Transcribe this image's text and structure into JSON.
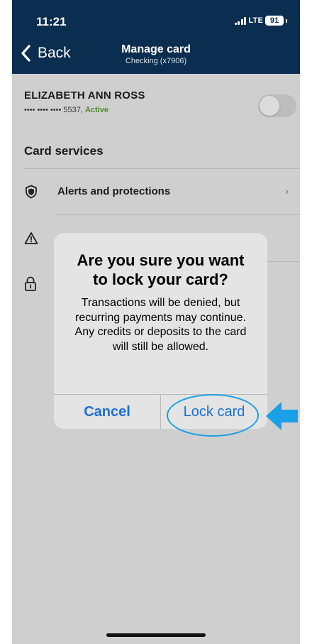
{
  "status_bar": {
    "time": "11:21",
    "network": "LTE",
    "battery": "91"
  },
  "nav": {
    "back_label": "Back",
    "title": "Manage card",
    "subtitle": "Checking (x7906)"
  },
  "card": {
    "holder_name": "ELIZABETH ANN ROSS",
    "masked_number": "•••• •••• •••• 5537,",
    "status": "Active",
    "toggle_on": false
  },
  "card_services": {
    "title": "Card services",
    "items": [
      {
        "label": "Alerts and protections",
        "icon": "shield-icon",
        "chevron": "›"
      },
      {
        "label": "",
        "icon": "warning-icon"
      },
      {
        "label": "",
        "icon": "lock-icon"
      }
    ]
  },
  "dialog": {
    "title": "Are you sure you want to lock your card?",
    "message": "Transactions will be denied, but recurring payments may continue. Any credits or deposits to the card will still be allowed.",
    "cancel_label": "Cancel",
    "confirm_label": "Lock card"
  },
  "colors": {
    "nav_background": "#0b2d4f",
    "accent_blue": "#1a6fd6",
    "active_green": "#4b8a2d",
    "annotation_cyan": "#1aa0e6"
  }
}
